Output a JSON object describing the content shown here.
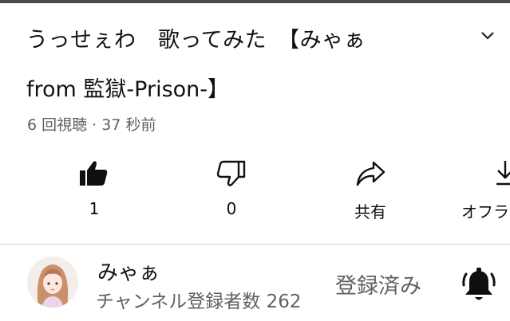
{
  "player": {
    "progress": 1.0,
    "progress_color": "#4a4a4a"
  },
  "video": {
    "title_line1": "うっせぇわ　歌ってみた　【みゃぁ",
    "title_line2": "from 監獄-Prison-】",
    "meta": "6 回視聴 · 37 秒前",
    "expand_icon": "chevron-down-icon"
  },
  "actions": [
    {
      "id": "like",
      "icon": "thumbs-up-filled-icon",
      "label": "1"
    },
    {
      "id": "dislike",
      "icon": "thumbs-down-icon",
      "label": "0"
    },
    {
      "id": "share",
      "icon": "share-arrow-icon",
      "label": "共有"
    },
    {
      "id": "offline",
      "icon": "download-icon",
      "label": "オフラ"
    }
  ],
  "channel": {
    "name": "みゃぁ",
    "subscribers": "チャンネル登録者数 262",
    "subscribe_label": "登録済み",
    "avatar_icon": "channel-avatar",
    "bell_icon": "notification-bell-icon"
  },
  "colors": {
    "text": "#0f0f0f",
    "secondary": "#606060",
    "divider": "#d8d8d8"
  }
}
